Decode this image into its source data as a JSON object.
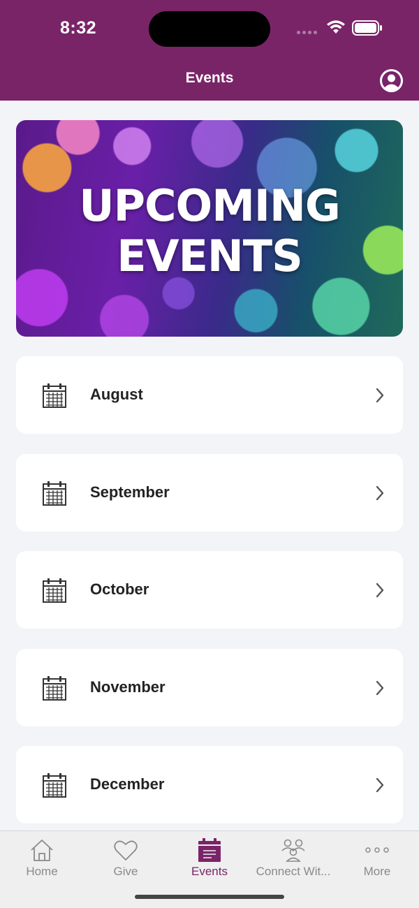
{
  "status": {
    "time": "8:32"
  },
  "header": {
    "title": "Events",
    "profile_icon": "user-circle-icon",
    "background": "#7a2468"
  },
  "banner": {
    "line1": "UPCOMING",
    "line2": "EVENTS"
  },
  "months": [
    {
      "label": "August"
    },
    {
      "label": "September"
    },
    {
      "label": "October"
    },
    {
      "label": "November"
    },
    {
      "label": "December"
    }
  ],
  "tabs": [
    {
      "label": "Home",
      "icon": "home-icon",
      "active": false
    },
    {
      "label": "Give",
      "icon": "heart-icon",
      "active": false
    },
    {
      "label": "Events",
      "icon": "calendar-icon",
      "active": true
    },
    {
      "label": "Connect Wit...",
      "icon": "people-icon",
      "active": false
    },
    {
      "label": "More",
      "icon": "more-icon",
      "active": false
    }
  ],
  "colors": {
    "accent": "#7a2468",
    "tab_inactive": "#8a8a8a",
    "page_background": "#f3f4f8"
  }
}
